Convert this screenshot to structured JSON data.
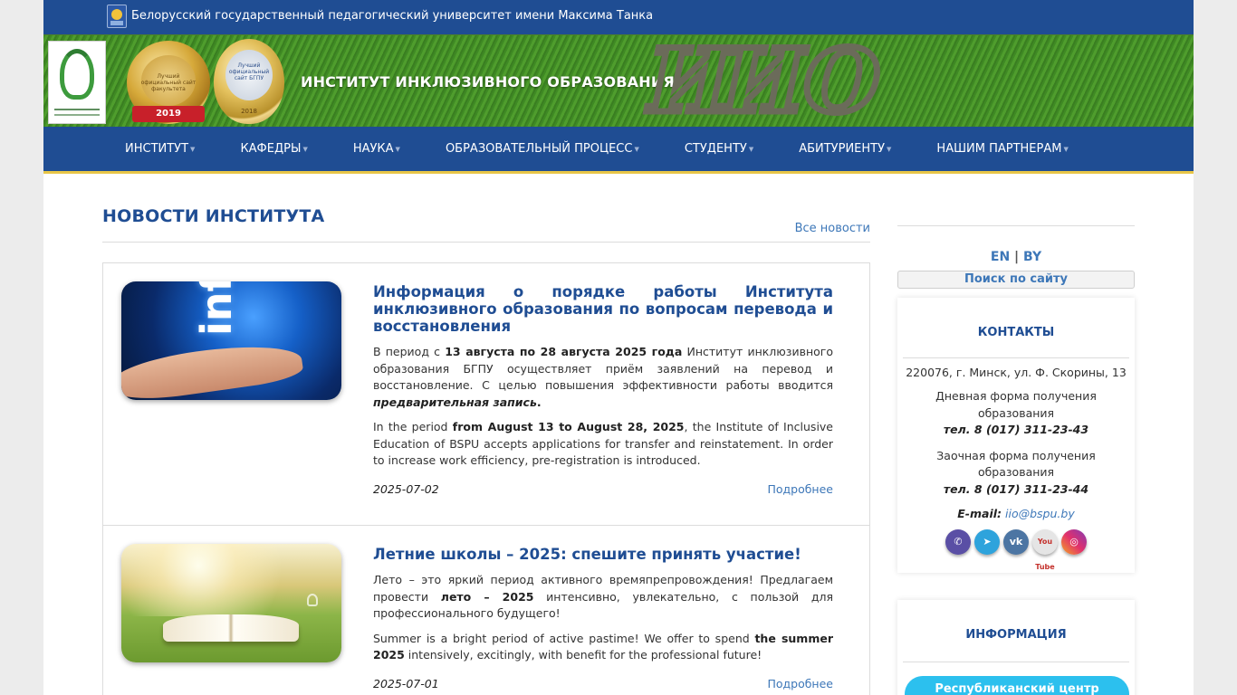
{
  "topbar": {
    "university_title": "Белорусский государственный педагогический университет имени Максима Танка"
  },
  "banner": {
    "institute_title": "ИНСТИТУТ ИНКЛЮЗИВНОГО ОБРАЗОВАНИЯ",
    "medal1": {
      "text": "Лучший официальный сайт факультета",
      "year": "2019"
    },
    "medal2": {
      "text": "Лучший официальный сайт БГПУ",
      "year": "2018"
    },
    "people_letters": [
      "И",
      "И",
      "О"
    ]
  },
  "nav": {
    "items": [
      {
        "label": "ИНСТИТУТ"
      },
      {
        "label": "КАФЕДРЫ"
      },
      {
        "label": "НАУКА"
      },
      {
        "label": "ОБРАЗОВАТЕЛЬНЫЙ ПРОЦЕСС"
      },
      {
        "label": "СТУДЕНТУ"
      },
      {
        "label": "АБИТУРИЕНТУ"
      },
      {
        "label": "НАШИМ ПАРТНЕРАМ"
      }
    ]
  },
  "news": {
    "section_title": "НОВОСТИ ИНСТИТУТА",
    "all_news_label": "Все новости",
    "items": [
      {
        "title": "Информация о порядке работы Института инклюзивного образования по вопросам перевода и восстановления",
        "ru_before": "В период с ",
        "ru_bold1": "13 августа по 28 августа 2025 года",
        "ru_middle": " Институт инклюзивного образования БГПУ осуществляет приём заявлений на перевод и восстановление. С целью повышения эффективности работы вводится ",
        "ru_bold2": "предварительная запись",
        "ru_after": ".",
        "en_before": "In the period ",
        "en_bold": "from August 13 to August 28, 2025",
        "en_after": ", the Institute of Inclusive Education of BSPU accepts applications for transfer and reinstatement. In order to increase work efficiency, pre-registration is introduced.",
        "thumb_word": "info",
        "date": "2025-07-02",
        "more_label": "Подробнее"
      },
      {
        "title": "Летние школы – 2025: спешите принять участие!",
        "ru_before": "Лето – это яркий период активного времяпрепровождения! Предлагаем провести ",
        "ru_bold1": "лето – 2025",
        "ru_after": " интенсивно, увлекательно, с пользой для профессионального будущего!",
        "en_before": "Summer is a bright period of active pastime! We offer to spend ",
        "en_bold": "the summer 2025",
        "en_after": " intensively, excitingly, with benefit for the professional future!",
        "date": "2025-07-01",
        "more_label": "Подробнее"
      }
    ]
  },
  "sidebar": {
    "lang_en": "EN",
    "lang_sep": "|",
    "lang_by": "BY",
    "search_label": "Поиск по сайту",
    "contacts": {
      "title": "КОНТАКТЫ",
      "address": "220076, г. Минск, ул. Ф. Скорины, 13",
      "day_form": "Дневная форма получения образования",
      "day_tel": "тел. 8 (017) 311-23-43",
      "extramural_form": "Заочная форма получения образования",
      "extramural_tel": "тел. 8 (017) 311-23-44",
      "email_label": "E-mail:",
      "email": "iio@bspu.by",
      "socials": [
        "viber",
        "telegram",
        "vk",
        "youtube",
        "instagram"
      ],
      "youtube_text": "You Tube"
    },
    "info": {
      "title": "ИНФОРМАЦИЯ",
      "button_label": "Республиканский центр"
    }
  },
  "colors": {
    "brand_blue": "#1f4d93",
    "link_blue": "#3d77b8",
    "nav_underline": "#e8c547",
    "info_button": "#2cc0ee"
  }
}
